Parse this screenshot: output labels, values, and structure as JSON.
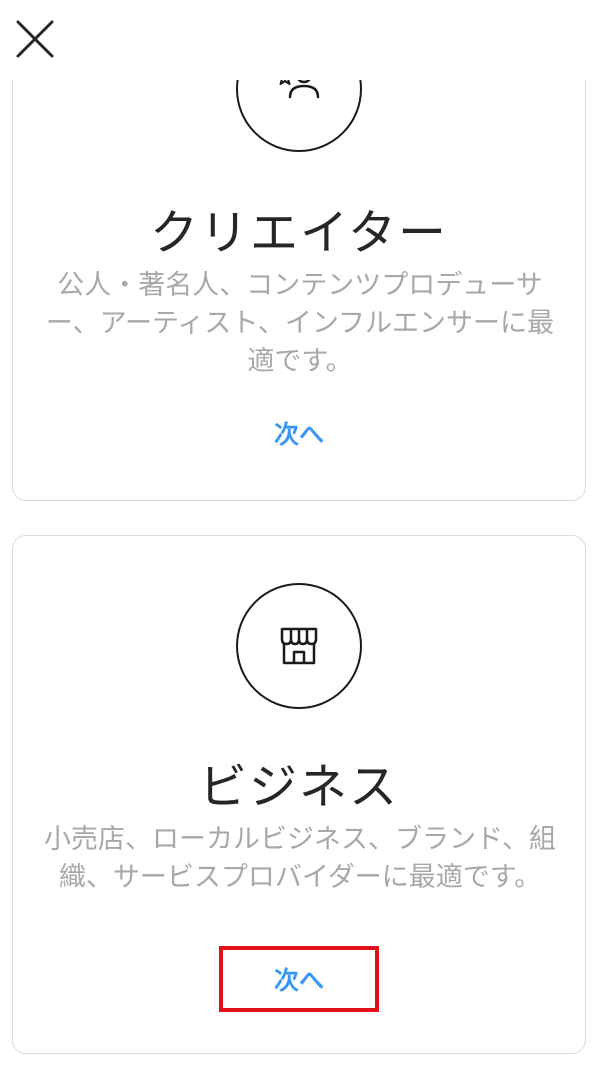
{
  "header": {
    "close_icon": "close-icon"
  },
  "cards": [
    {
      "id": "creator",
      "icon": "creator-star-person-icon",
      "title": "クリエイター",
      "description": "公人・著名人、コンテンツプロデューサー、アーティスト、インフルエンサーに最適です。",
      "next_label": "次へ"
    },
    {
      "id": "business",
      "icon": "storefront-icon",
      "title": "ビジネス",
      "description": "小売店、ローカルビジネス、ブランド、組織、サービスプロバイダーに最適です。",
      "next_label": "次へ"
    }
  ],
  "colors": {
    "accent": "#3897f0",
    "highlight": "#e0101a",
    "text": "#262626",
    "muted": "#a8a8a8",
    "border": "#dbdbdb"
  }
}
